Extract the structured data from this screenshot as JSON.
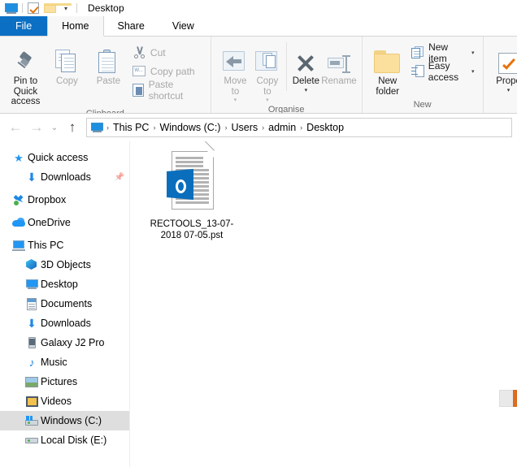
{
  "window": {
    "title": "Desktop",
    "quick_access_toolbar": [
      {
        "name": "this-pc-icon",
        "label": "This PC"
      },
      {
        "name": "properties-icon",
        "label": "Properties"
      },
      {
        "name": "new-folder-icon",
        "label": "New folder"
      },
      {
        "name": "customize-chevron-icon",
        "label": "▾"
      }
    ]
  },
  "tabs": [
    {
      "label": "File",
      "type": "file"
    },
    {
      "label": "Home",
      "type": "active"
    },
    {
      "label": "Share",
      "type": "normal"
    },
    {
      "label": "View",
      "type": "normal"
    }
  ],
  "ribbon": {
    "groups": [
      {
        "label": "Clipboard",
        "big_buttons": [
          {
            "label": "Pin to Quick access",
            "icon": "pin-icon",
            "disabled": false
          },
          {
            "label": "Copy",
            "icon": "copy-icon",
            "disabled": true
          },
          {
            "label": "Paste",
            "icon": "paste-icon",
            "disabled": true
          }
        ],
        "small_buttons": [
          {
            "label": "Cut",
            "icon": "scissors-icon",
            "disabled": true
          },
          {
            "label": "Copy path",
            "icon": "copy-path-icon",
            "disabled": true
          },
          {
            "label": "Paste shortcut",
            "icon": "paste-shortcut-icon",
            "disabled": true
          }
        ]
      },
      {
        "label": "Organise",
        "big_buttons": [
          {
            "label": "Move to",
            "icon": "move-to-icon",
            "disabled": true,
            "caret": true
          },
          {
            "label": "Copy to",
            "icon": "copy-to-icon",
            "disabled": true,
            "caret": true
          },
          {
            "label": "Delete",
            "icon": "delete-icon",
            "disabled": false,
            "caret": true
          },
          {
            "label": "Rename",
            "icon": "rename-icon",
            "disabled": true
          }
        ]
      },
      {
        "label": "New",
        "big_buttons": [
          {
            "label": "New folder",
            "icon": "new-folder-icon",
            "disabled": false
          }
        ],
        "small_buttons": [
          {
            "label": "New item",
            "icon": "new-item-icon",
            "disabled": false,
            "caret": true
          },
          {
            "label": "Easy access",
            "icon": "easy-access-icon",
            "disabled": false,
            "caret": true
          }
        ]
      },
      {
        "label": "",
        "big_buttons": [
          {
            "label": "Prope",
            "icon": "properties-check-icon",
            "disabled": false,
            "caret": true
          }
        ]
      }
    ]
  },
  "address_bar": {
    "back": {
      "name": "back-button",
      "glyph": "←",
      "enabled": false
    },
    "forward": {
      "name": "forward-button",
      "glyph": "→",
      "enabled": false
    },
    "recent": {
      "name": "recent-locations-button",
      "glyph": "⌄",
      "enabled": false
    },
    "up": {
      "name": "up-button",
      "glyph": "↑",
      "enabled": true
    },
    "breadcrumbs": [
      "This PC",
      "Windows (C:)",
      "Users",
      "admin",
      "Desktop"
    ],
    "separator": "›"
  },
  "sidebar": {
    "items": [
      {
        "label": "Quick access",
        "icon": "quick-access-star-icon",
        "indent": 0,
        "selected": false,
        "pinned": false
      },
      {
        "label": "Downloads",
        "icon": "downloads-arrow-icon",
        "indent": 1,
        "selected": false,
        "pinned": true
      },
      {
        "label": "Dropbox",
        "icon": "dropbox-icon",
        "indent": 0,
        "selected": false,
        "pinned": false
      },
      {
        "label": "OneDrive",
        "icon": "onedrive-cloud-icon",
        "indent": 0,
        "selected": false,
        "pinned": false
      },
      {
        "label": "This PC",
        "icon": "this-pc-monitor-icon",
        "indent": 0,
        "selected": false,
        "pinned": false
      },
      {
        "label": "3D Objects",
        "icon": "3d-objects-icon",
        "indent": 1,
        "selected": false,
        "pinned": false
      },
      {
        "label": "Desktop",
        "icon": "desktop-icon",
        "indent": 1,
        "selected": false,
        "pinned": false
      },
      {
        "label": "Documents",
        "icon": "documents-icon",
        "indent": 1,
        "selected": false,
        "pinned": false
      },
      {
        "label": "Downloads",
        "icon": "downloads-arrow-icon",
        "indent": 1,
        "selected": false,
        "pinned": false
      },
      {
        "label": "Galaxy J2 Pro",
        "icon": "phone-icon",
        "indent": 1,
        "selected": false,
        "pinned": false
      },
      {
        "label": "Music",
        "icon": "music-note-icon",
        "indent": 1,
        "selected": false,
        "pinned": false
      },
      {
        "label": "Pictures",
        "icon": "pictures-icon",
        "indent": 1,
        "selected": false,
        "pinned": false
      },
      {
        "label": "Videos",
        "icon": "videos-icon",
        "indent": 1,
        "selected": false,
        "pinned": false
      },
      {
        "label": "Windows (C:)",
        "icon": "windows-drive-icon",
        "indent": 1,
        "selected": true,
        "pinned": false
      },
      {
        "label": "Local Disk (E:)",
        "icon": "local-disk-icon",
        "indent": 1,
        "selected": false,
        "pinned": false
      }
    ]
  },
  "content": {
    "files": [
      {
        "name": "RECTOOLS_13-07-2018 07-05.pst",
        "icon": "outlook-pst-file-icon",
        "badge_letter": "O"
      }
    ]
  },
  "colors": {
    "accent_blue": "#0b6fc4",
    "outlook_blue": "#0a6ebd",
    "ribbon_bg": "#f7f7f7",
    "selection_gray": "#dededf",
    "orange": "#e8720c"
  }
}
